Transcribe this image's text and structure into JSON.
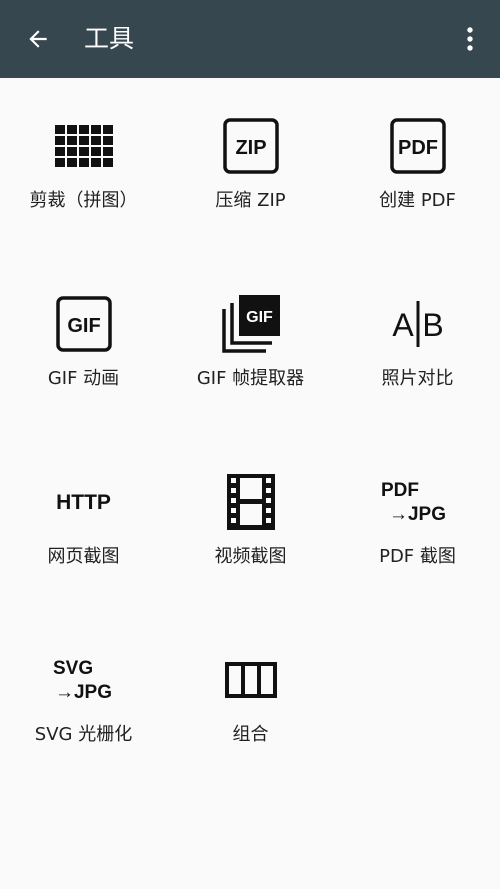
{
  "appbar": {
    "title": "工具",
    "back_icon": "arrow-back-icon",
    "more_icon": "more-vert-icon",
    "background": "#37474f"
  },
  "tools": [
    {
      "label": "剪裁（拼图）",
      "icon": "grid-crop-icon"
    },
    {
      "label": "压缩 ZIP",
      "icon": "zip-icon",
      "icon_text": "ZIP"
    },
    {
      "label": "创建 PDF",
      "icon": "pdf-icon",
      "icon_text": "PDF"
    },
    {
      "label": "GIF 动画",
      "icon": "gif-icon",
      "icon_text": "GIF"
    },
    {
      "label": "GIF 帧提取器",
      "icon": "gif-frames-icon",
      "icon_text": "GIF"
    },
    {
      "label": "照片对比",
      "icon": "compare-icon",
      "icon_text_left": "A",
      "icon_text_right": "B"
    },
    {
      "label": "网页截图",
      "icon": "http-icon",
      "icon_text": "HTTP"
    },
    {
      "label": "视频截图",
      "icon": "film-icon"
    },
    {
      "label": "PDF 截图",
      "icon": "pdf-to-jpg-icon",
      "icon_text_top": "PDF",
      "icon_text_bottom": "→JPG"
    },
    {
      "label": "SVG 光栅化",
      "icon": "svg-to-jpg-icon",
      "icon_text_top": "SVG",
      "icon_text_bottom": "→JPG"
    },
    {
      "label": "组合",
      "icon": "columns-icon"
    }
  ]
}
